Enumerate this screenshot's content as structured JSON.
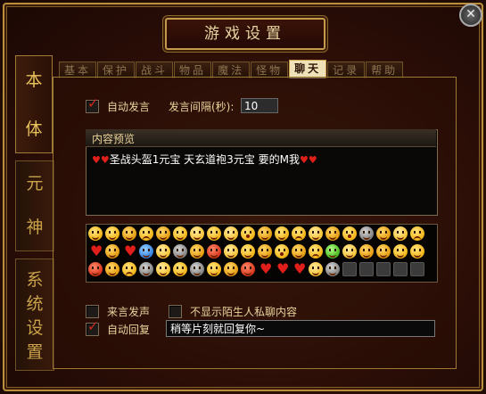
{
  "window": {
    "title": "游戏设置",
    "close_label": "✕"
  },
  "sidebar": {
    "tabs": [
      {
        "chars": [
          "本",
          "体"
        ],
        "active": true
      },
      {
        "chars": [
          "元",
          "神"
        ],
        "active": false
      },
      {
        "chars": [
          "系",
          "统",
          "设",
          "置"
        ],
        "active": false
      }
    ]
  },
  "tabs": [
    {
      "label": "基本",
      "active": false
    },
    {
      "label": "保护",
      "active": false
    },
    {
      "label": "战斗",
      "active": false
    },
    {
      "label": "物品",
      "active": false
    },
    {
      "label": "魔法",
      "active": false
    },
    {
      "label": "怪物",
      "active": false
    },
    {
      "label": "聊天",
      "active": true
    },
    {
      "label": "记录",
      "active": false
    },
    {
      "label": "帮助",
      "active": false
    }
  ],
  "chat": {
    "auto_speak": {
      "label": "自动发言",
      "checked": true
    },
    "interval": {
      "label": "发言间隔(秒):",
      "value": "10"
    },
    "preview": {
      "title": "内容预览",
      "heart": "♥♥",
      "text": "圣战头盔1元宝 天玄道袍3元宝 要的M我"
    },
    "emotes": [
      "smile",
      "smile",
      "v1",
      "v3",
      "v1",
      "smile",
      "v2",
      "smile",
      "v2",
      "v4",
      "v1",
      "smile",
      "v3",
      "v2",
      "v1",
      "v4",
      "other",
      "v1",
      "v2",
      "v3",
      "heart",
      "v1",
      "heart",
      "blue",
      "v2",
      "other",
      "v1",
      "red",
      "v2",
      "smile",
      "v1",
      "v4",
      "v1",
      "v3",
      "green",
      "v2",
      "v1",
      "v1",
      "smile",
      "smile",
      "red",
      "v1",
      "v3",
      "other",
      "v2",
      "smile",
      "other",
      "smile",
      "v1",
      "red",
      "heart",
      "heart",
      "heart",
      "v2",
      "other",
      "empty",
      "empty",
      "empty",
      "empty",
      "empty"
    ],
    "incoming_sound": {
      "label": "来言发声",
      "checked": false
    },
    "block_stranger": {
      "label": "不显示陌生人私聊内容",
      "checked": false
    },
    "auto_reply": {
      "label": "自动回复",
      "checked": true,
      "value": "稍等片刻就回复你~"
    }
  },
  "colors": {
    "accent_gold": "#c9a24a",
    "bg_dark": "#2a0f08",
    "checkbox_mark": "#d2291c"
  }
}
